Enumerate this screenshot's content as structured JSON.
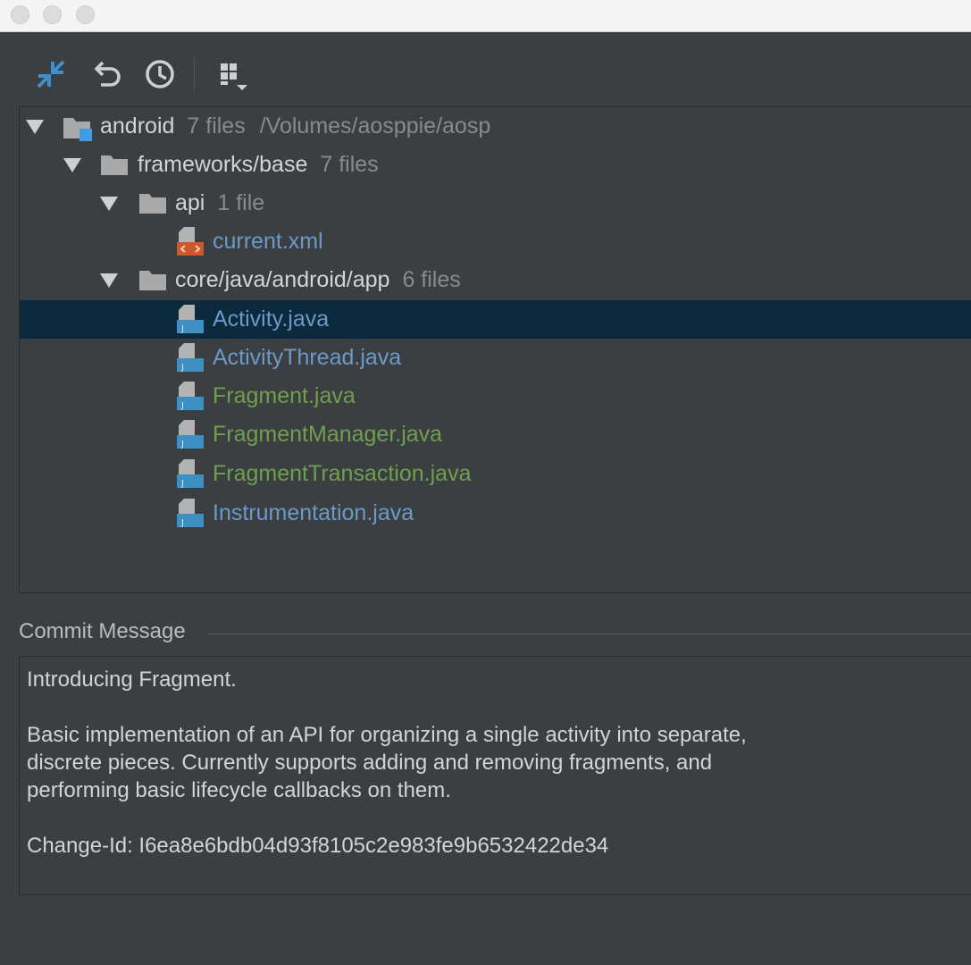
{
  "toolbar": {
    "icons": [
      "collapse-all-icon",
      "rollback-icon",
      "history-icon",
      "group-by-icon"
    ]
  },
  "tree": {
    "root": {
      "name": "android",
      "count": "7 files",
      "path": "/Volumes/aosppie/aosp"
    },
    "frameworks": {
      "name": "frameworks/base",
      "count": "7 files"
    },
    "api": {
      "name": "api",
      "count": "1 file"
    },
    "current_xml": {
      "name": "current.xml"
    },
    "app": {
      "name": "core/java/android/app",
      "count": "6 files"
    },
    "files": [
      {
        "name": "Activity.java",
        "status": "modified",
        "selected": true
      },
      {
        "name": "ActivityThread.java",
        "status": "modified",
        "selected": false
      },
      {
        "name": "Fragment.java",
        "status": "added",
        "selected": false
      },
      {
        "name": "FragmentManager.java",
        "status": "added",
        "selected": false
      },
      {
        "name": "FragmentTransaction.java",
        "status": "added",
        "selected": false
      },
      {
        "name": "Instrumentation.java",
        "status": "modified",
        "selected": false
      }
    ]
  },
  "commit": {
    "label": "Commit Message",
    "message": "Introducing Fragment.\n\nBasic implementation of an API for organizing a single activity into separate,\ndiscrete pieces. Currently supports adding and removing fragments, and\nperforming basic lifecycle callbacks on them.\n\nChange-Id: I6ea8e6bdb04d93f8105c2e983fe9b6532422de34"
  },
  "colors": {
    "background": "#3c3f41",
    "selection": "#0d293e",
    "modified_file": "#6b9ac8",
    "added_file": "#6f9f4f",
    "muted_text": "#8a8a8a",
    "accent_blue": "#3d8fd1"
  }
}
